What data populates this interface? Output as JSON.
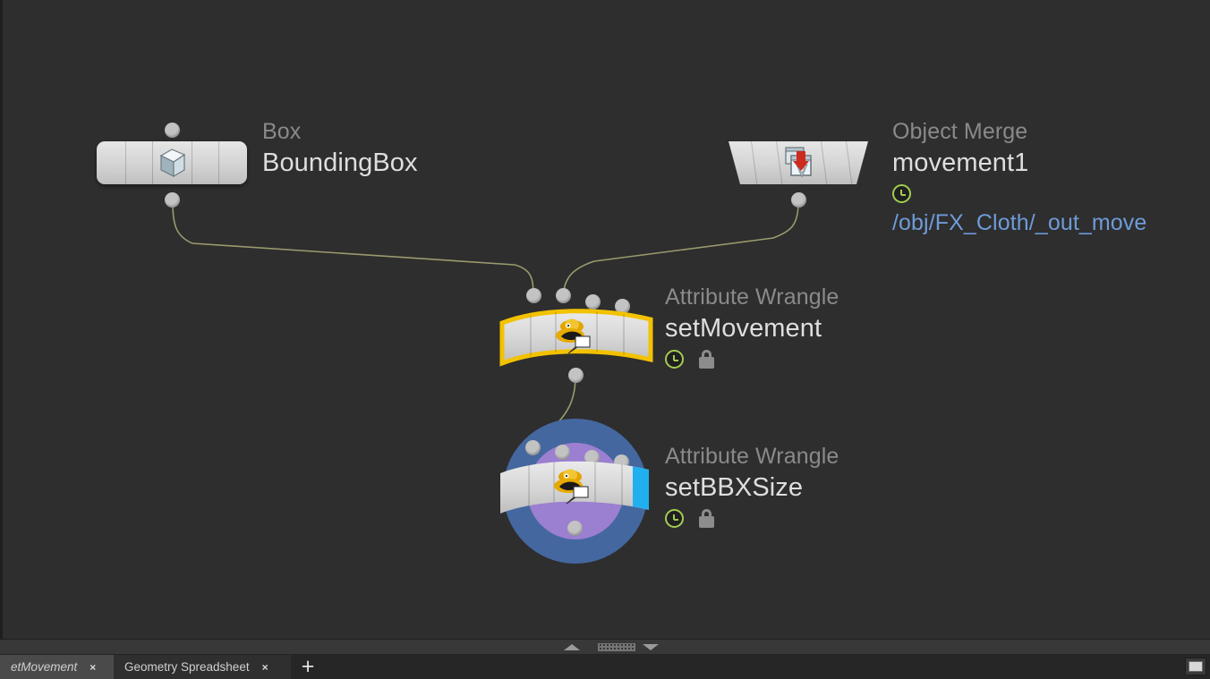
{
  "app": {
    "background_color": "#2e2e2e",
    "wire_color": "#9a9a6e"
  },
  "network": {
    "nodes": [
      {
        "id": "boundingbox",
        "type_label": "Box",
        "name": "BoundingBox",
        "icon": "cube-icon",
        "shape": "rounded-rect",
        "selected": false,
        "badges": [],
        "path_label": "",
        "inputs": 1,
        "outputs": 1
      },
      {
        "id": "movement1",
        "type_label": "Object Merge",
        "name": "movement1",
        "icon": "object-merge-icon",
        "shape": "trapezoid",
        "selected": false,
        "badges": [
          "time-dependent"
        ],
        "path_label": "/obj/FX_Cloth/_out_move",
        "inputs": 0,
        "outputs": 1
      },
      {
        "id": "setmovement",
        "type_label": "Attribute Wrangle",
        "name": "setMovement",
        "icon": "wrangle-icon",
        "shape": "wavy-ribbon",
        "selected": true,
        "badges": [
          "time-dependent",
          "locked"
        ],
        "path_label": "",
        "inputs": 4,
        "outputs": 1
      },
      {
        "id": "setbbxsize",
        "type_label": "Attribute Wrangle",
        "name": "setBBXSize",
        "icon": "wrangle-icon",
        "shape": "wavy-ribbon",
        "selected": false,
        "display_flag": true,
        "render_flag": true,
        "badges": [
          "time-dependent",
          "locked"
        ],
        "path_label": "",
        "inputs": 4,
        "outputs": 1
      }
    ],
    "flag_colors": {
      "display_ring": "#44679f",
      "render_inner": "#9b7fd0",
      "template_bar": "#21b0ef"
    },
    "selection_color": "#f2c200"
  },
  "bottom": {
    "splitter": {
      "up_arrow": "collapse-up",
      "down_arrow": "collapse-down",
      "grip": "drag-grip"
    },
    "tabs": [
      {
        "label": "etMovement",
        "close": "×",
        "active": false
      },
      {
        "label": "Geometry Spreadsheet",
        "close": "×",
        "active": true
      }
    ],
    "add_tab_label": "+"
  }
}
